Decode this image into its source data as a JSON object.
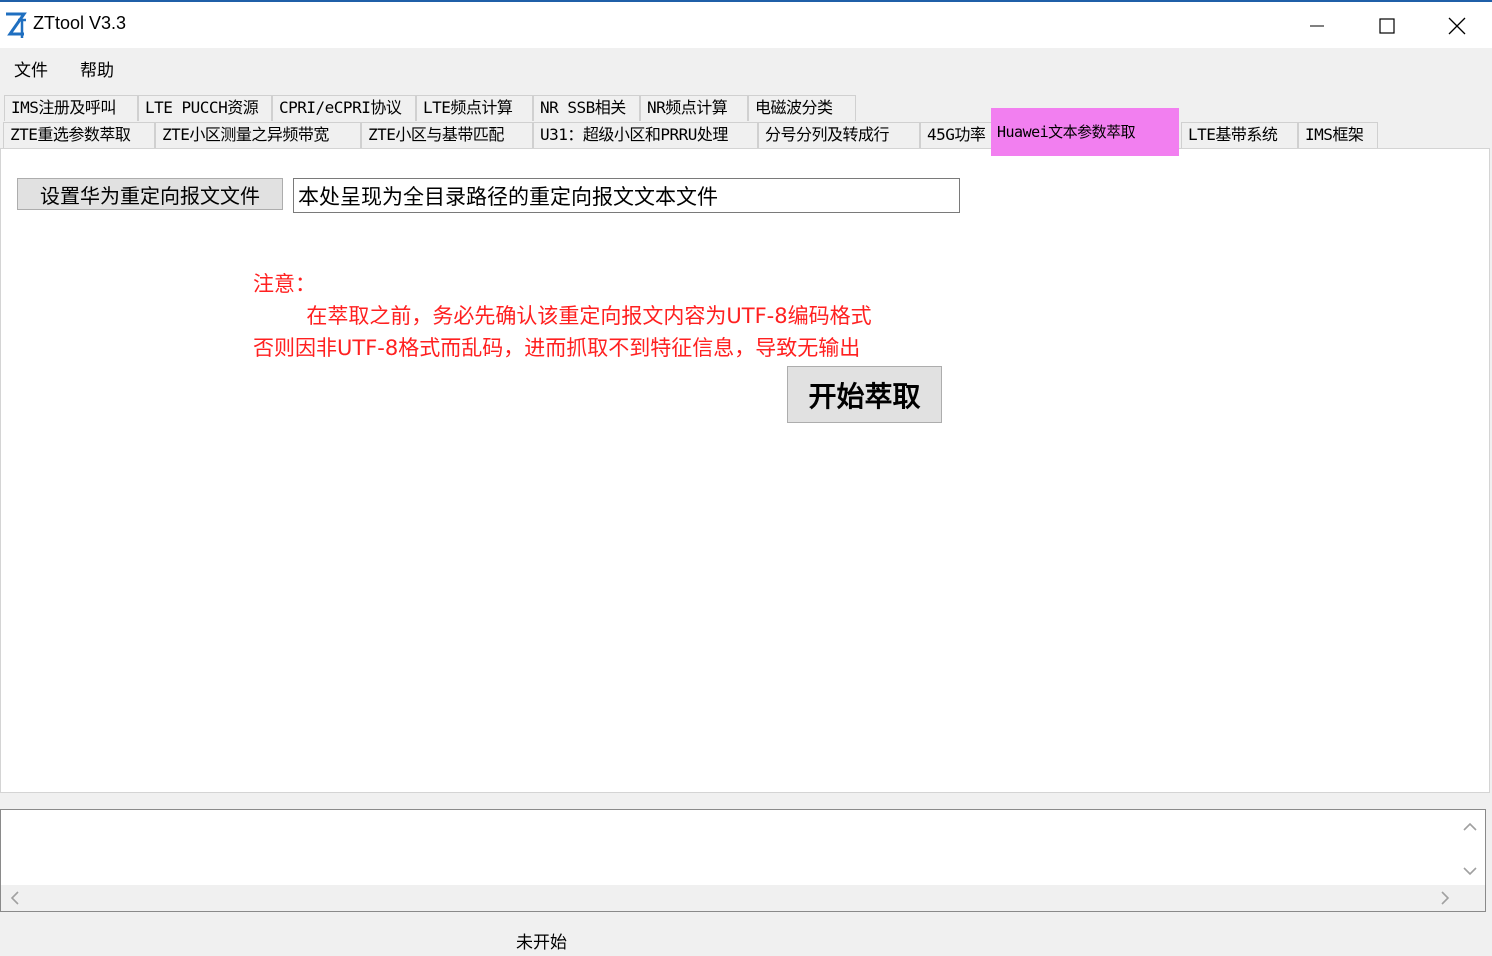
{
  "window": {
    "title": "ZTtool V3.3"
  },
  "menu": {
    "items": [
      "文件",
      "帮助"
    ]
  },
  "tabs": {
    "row1": [
      "IMS注册及呼叫",
      "LTE PUCCH资源",
      "CPRI/eCPRI协议",
      "LTE频点计算",
      "NR SSB相关",
      "NR频点计算",
      "电磁波分类"
    ],
    "row2": [
      "ZTE重选参数萃取",
      "ZTE小区测量之异频带宽",
      "ZTE小区与基带匹配",
      "U31：超级小区和PRRU处理",
      "分号分列及转成行",
      "45G功率",
      "Huawei文本参数萃取",
      "LTE基带系统",
      "IMS框架"
    ],
    "active": "Huawei文本参数萃取",
    "active_color": "#f27ff0"
  },
  "panel": {
    "set_file_button": "设置华为重定向报文文件",
    "file_path_placeholder": "本处呈现为全目录路径的重定向报文文本文件",
    "note_title": "注意：",
    "note_line1": "        在萃取之前，务必先确认该重定向报文内容为UTF-8编码格式",
    "note_line2": "否则因非UTF-8格式而乱码，进而抓取不到特征信息，导致无输出",
    "note_color": "#ff2020",
    "start_button": "开始萃取"
  },
  "status": {
    "text": "未开始"
  }
}
